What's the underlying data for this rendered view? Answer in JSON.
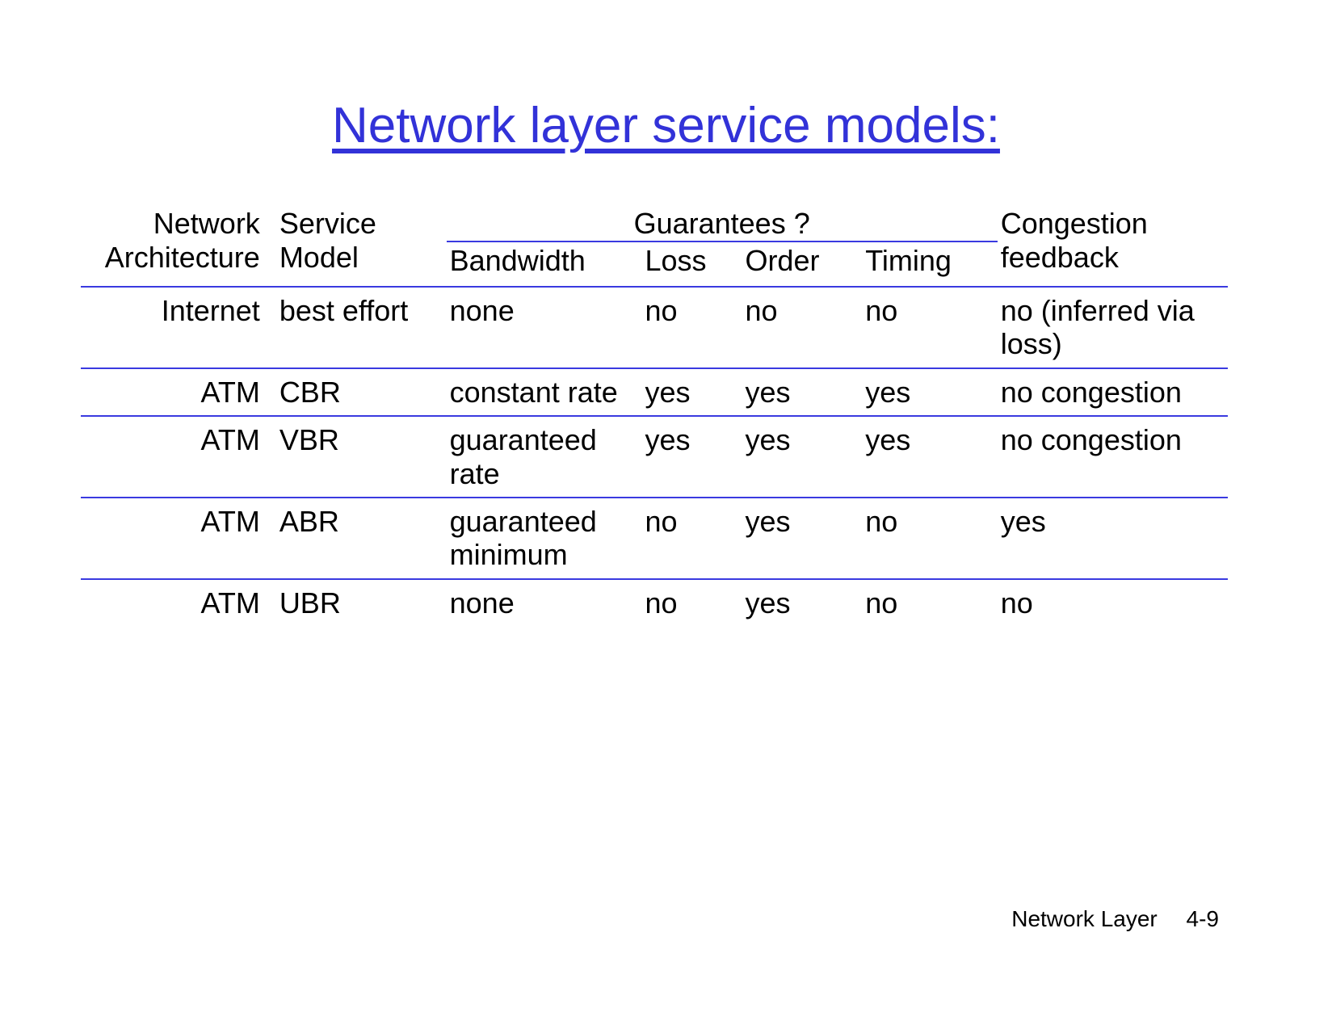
{
  "title": "Network layer service models:",
  "headers": {
    "architecture": "Network Architecture",
    "service_model": "Service Model",
    "guarantees_group": "Guarantees ?",
    "bandwidth": "Bandwidth",
    "loss": "Loss",
    "order": "Order",
    "timing": "Timing",
    "congestion": "Congestion feedback"
  },
  "rows": [
    {
      "architecture": "Internet",
      "service_model": "best effort",
      "bandwidth": "none",
      "loss": "no",
      "order": "no",
      "timing": "no",
      "congestion": "no (inferred via loss)"
    },
    {
      "architecture": "ATM",
      "service_model": "CBR",
      "bandwidth": "constant rate",
      "loss": "yes",
      "order": "yes",
      "timing": "yes",
      "congestion": "no congestion"
    },
    {
      "architecture": "ATM",
      "service_model": "VBR",
      "bandwidth": "guaranteed rate",
      "loss": "yes",
      "order": "yes",
      "timing": "yes",
      "congestion": "no congestion"
    },
    {
      "architecture": "ATM",
      "service_model": "ABR",
      "bandwidth": "guaranteed minimum",
      "loss": "no",
      "order": "yes",
      "timing": "no",
      "congestion": "yes"
    },
    {
      "architecture": "ATM",
      "service_model": "UBR",
      "bandwidth": "none",
      "loss": "no",
      "order": "yes",
      "timing": "no",
      "congestion": "no"
    }
  ],
  "footer": {
    "label": "Network Layer",
    "page": "4-9"
  },
  "chart_data": {
    "type": "table",
    "title": "Network layer service models:",
    "columns": [
      "Network Architecture",
      "Service Model",
      "Bandwidth",
      "Loss",
      "Order",
      "Timing",
      "Congestion feedback"
    ],
    "group_header": {
      "label": "Guarantees ?",
      "spans_columns": [
        "Bandwidth",
        "Loss",
        "Order",
        "Timing"
      ]
    },
    "rows": [
      [
        "Internet",
        "best effort",
        "none",
        "no",
        "no",
        "no",
        "no (inferred via loss)"
      ],
      [
        "ATM",
        "CBR",
        "constant rate",
        "yes",
        "yes",
        "yes",
        "no congestion"
      ],
      [
        "ATM",
        "VBR",
        "guaranteed rate",
        "yes",
        "yes",
        "yes",
        "no congestion"
      ],
      [
        "ATM",
        "ABR",
        "guaranteed minimum",
        "no",
        "yes",
        "no",
        "yes"
      ],
      [
        "ATM",
        "UBR",
        "none",
        "no",
        "yes",
        "no",
        "no"
      ]
    ]
  }
}
